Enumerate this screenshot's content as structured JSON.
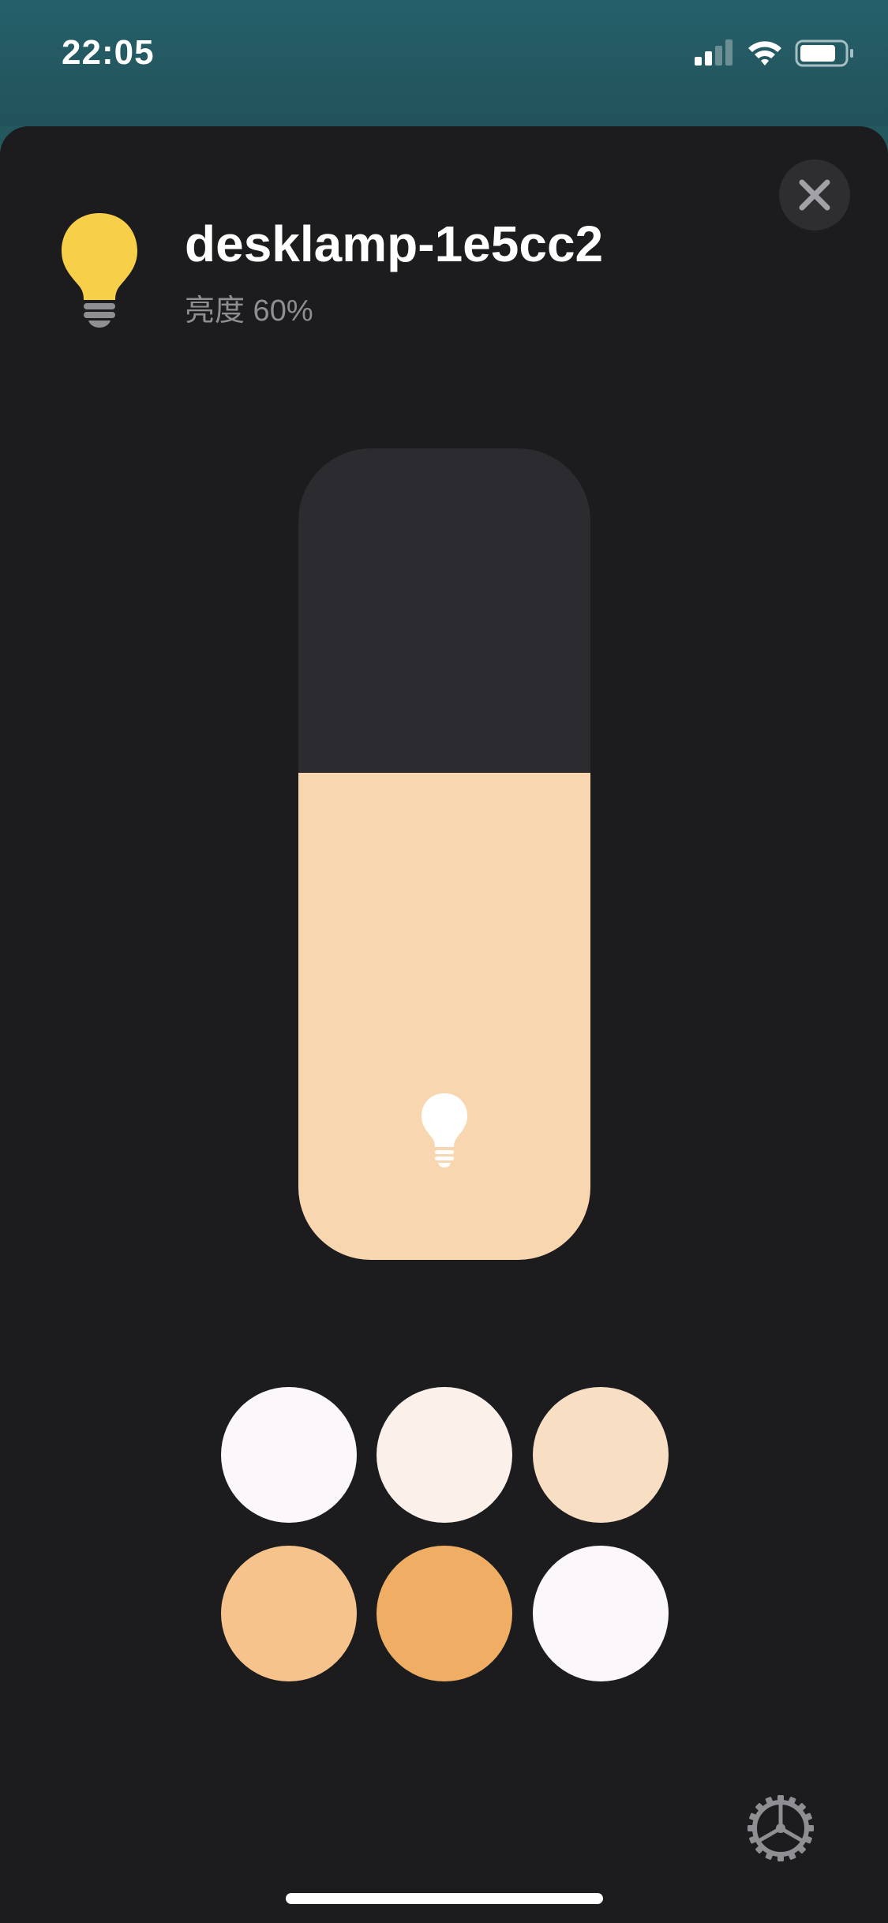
{
  "status_bar": {
    "time": "22:05",
    "icons": [
      "cellular-signal-icon",
      "wifi-icon",
      "battery-icon"
    ]
  },
  "header": {
    "device_name": "desklamp-1e5cc2",
    "brightness_label": "亮度 60%",
    "icon": "lightbulb-icon",
    "icon_color": "#f8cf48"
  },
  "close_icon": "close-icon",
  "slider": {
    "brightness": 0.6,
    "fill_color": "#f8d6af",
    "track_color": "#2c2b30",
    "icon": "lightbulb-icon"
  },
  "swatches": [
    "#fcf7fb",
    "#fbf1ea",
    "#f8dfc3",
    "#f5c38b",
    "#f0ae64",
    "#fcf7fb"
  ],
  "settings_icon": "gear-icon"
}
